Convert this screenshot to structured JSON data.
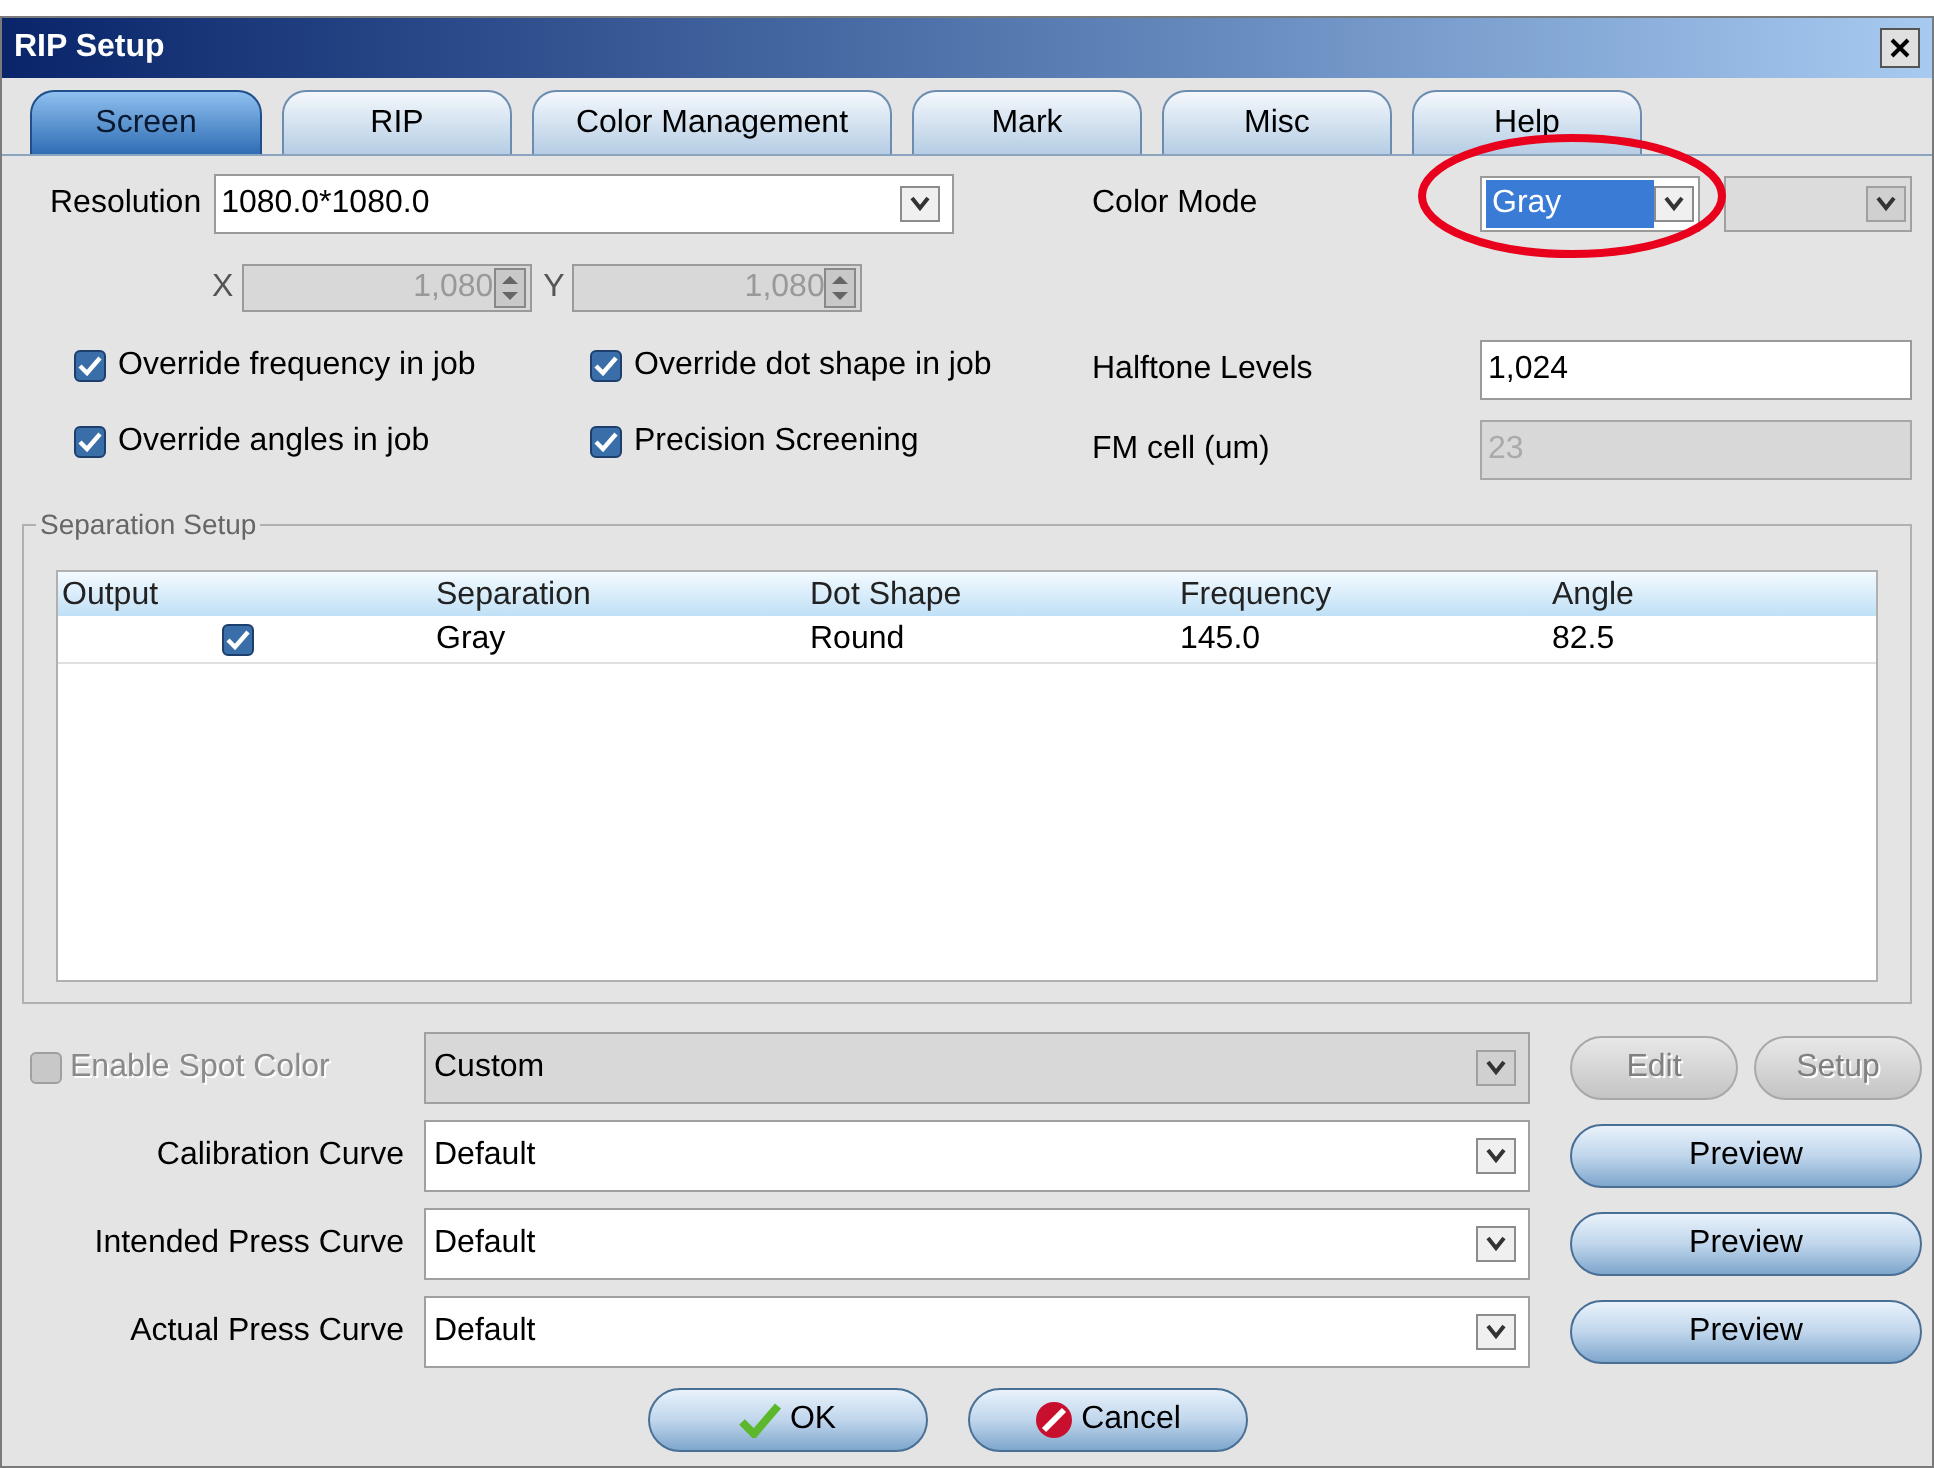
{
  "window": {
    "title": "RIP Setup"
  },
  "tabs": [
    {
      "label": "Screen",
      "selected": true
    },
    {
      "label": "RIP",
      "selected": false
    },
    {
      "label": "Color Management",
      "selected": false
    },
    {
      "label": "Mark",
      "selected": false
    },
    {
      "label": "Misc",
      "selected": false
    },
    {
      "label": "Help",
      "selected": false
    }
  ],
  "resolution": {
    "label": "Resolution",
    "value": "1080.0*1080.0"
  },
  "x": {
    "label": "X",
    "value": "1,080",
    "disabled": true
  },
  "y": {
    "label": "Y",
    "value": "1,080",
    "disabled": true
  },
  "options": [
    {
      "label": "Override frequency in job",
      "checked": true
    },
    {
      "label": "Override dot shape in job",
      "checked": true
    },
    {
      "label": "Override angles in job",
      "checked": true
    },
    {
      "label": "Precision Screening",
      "checked": true
    }
  ],
  "color_mode": {
    "label": "Color Mode",
    "value": "Gray"
  },
  "halftone_levels": {
    "label": "Halftone Levels",
    "value": "1,024",
    "disabled": false
  },
  "fm_cell": {
    "label": "FM cell (um)",
    "value": "23",
    "disabled": true
  },
  "separation_setup": {
    "title": "Separation Setup",
    "columns": [
      "Output",
      "Separation",
      "Dot Shape",
      "Frequency",
      "Angle"
    ],
    "rows": [
      {
        "cells": [
          {
            "kind": "checkbox",
            "checked": true
          },
          {
            "kind": "text",
            "text": "Gray"
          },
          {
            "kind": "text",
            "text": "Round"
          },
          {
            "kind": "text",
            "text": "145.0"
          },
          {
            "kind": "text",
            "text": "82.5"
          }
        ]
      }
    ]
  },
  "spot_color": {
    "label": "Enable Spot Color",
    "checked": false,
    "disabled": true,
    "value": "Custom",
    "buttons": [
      {
        "label": "Edit",
        "disabled": true
      },
      {
        "label": "Setup",
        "disabled": true
      }
    ]
  },
  "curves": [
    {
      "label": "Calibration Curve",
      "value": "Default",
      "button": "Preview"
    },
    {
      "label": "Intended Press Curve",
      "value": "Default",
      "button": "Preview"
    },
    {
      "label": "Actual Press Curve",
      "value": "Default",
      "button": "Preview"
    }
  ],
  "buttons": [
    {
      "label": "OK",
      "kind": "ok"
    },
    {
      "label": "Cancel",
      "kind": "cancel"
    }
  ]
}
